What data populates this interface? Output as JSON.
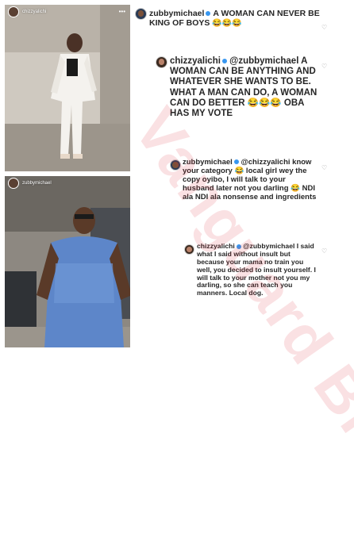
{
  "left_panel": {
    "top_post_user": "chizzyalichi",
    "bottom_post_user": "zubbymichael",
    "more_icon": "more-dots-icon"
  },
  "watermark": "Vanguard Blogs",
  "comments": [
    {
      "user": "zubbymichael",
      "text": "A WOMAN CAN NEVER BE KING OF BOYS",
      "emoji": "😂😂😂",
      "level": 0
    },
    {
      "user": "chizzyalichi",
      "text": "@zubbymichael A WOMAN CAN BE ANYTHING AND WHATEVER SHE WANTS TO BE. WHAT A MAN CAN DO, A WOMAN CAN DO BETTER 😂😂😂 OBA HAS MY VOTE",
      "level": 1
    },
    {
      "user": "zubbymichael",
      "text": "@chizzyalichi know your category 😂 local girl wey the copy oyibo, I will talk to your husband later not you darling 😂 NDI ala NDI ala nonsense and ingredients",
      "level": 2
    },
    {
      "user": "chizzyalichi",
      "text": "@zubbymichael I said what I said without insult but because your mama no train you well, you decided to insult yourself. I will talk to your mother not you my darling, so she can teach you manners. Local dog.",
      "level": 3
    }
  ],
  "icons": {
    "verified": "verified-badge-icon",
    "like": "heart-icon"
  },
  "colors": {
    "verified": "#3897f0",
    "watermark": "#dc283c",
    "text": "#262626"
  }
}
